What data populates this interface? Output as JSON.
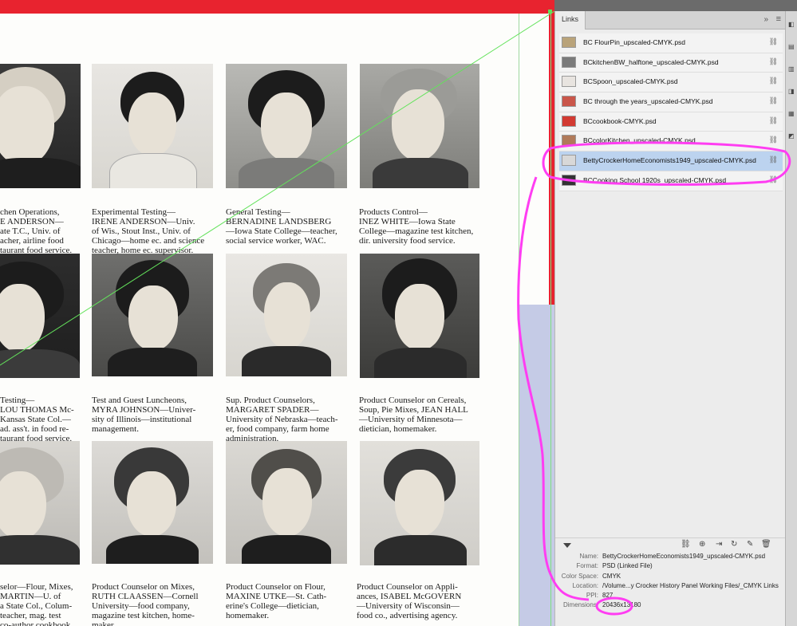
{
  "canvas": {
    "captions": [
      {
        "role": "chen Operations,",
        "lines": "E ANDERSON—\nate T.C., Univ. of\nacher, airline food\ntaurant food service."
      },
      {
        "role": "Experimental Testing—",
        "lines": "IRENE ANDERSON—Univ.\nof Wis., Stout Inst., Univ. of\nChicago—home ec. and science\nteacher, home ec. supervisor."
      },
      {
        "role": "General Testing—",
        "lines": "BERNADINE LANDSBERG\n—Iowa State College—teacher,\nsocial service worker, WAC."
      },
      {
        "role": "Products Control—",
        "lines": "INEZ WHITE—Iowa State\nCollege—magazine test kitchen,\ndir. university food service."
      },
      {
        "role": "Testing—",
        "lines": "LOU THOMAS Mc-\nKansas State Col.—\nad. ass't. in food re-\ntaurant food service."
      },
      {
        "role": "Test and Guest Luncheons,",
        "lines": "MYRA JOHNSON—Univer-\nsity of Illinois—institutional\nmanagement."
      },
      {
        "role": "Sup. Product Counselors,",
        "lines": "MARGARET SPADER—\nUniversity of Nebraska—teach-\ner, food company, farm home\nadministration."
      },
      {
        "role": "Product Counselor on Cereals,",
        "lines": "Soup, Pie Mixes, JEAN HALL\n—University of Minnesota—\ndietician, homemaker."
      },
      {
        "role": "selor—Flour, Mixes,",
        "lines": "MARTIN—U. of\na State Col., Colum-\nteacher, mag. test\nco-author cookbook."
      },
      {
        "role": "Product Counselor on Mixes,",
        "lines": "RUTH CLAASSEN—Cornell\nUniversity—food company,\nmagazine test kitchen, home-\nmaker."
      },
      {
        "role": "Product Counselor on Flour,",
        "lines": "MAXINE UTKE—St. Cath-\nerine's College—dietician,\nhomemaker."
      },
      {
        "role": "Product Counselor on Appli-",
        "lines": "ances, ISABEL McGOVERN\n—University of Wisconsin—\nfood co., advertising agency."
      }
    ]
  },
  "panel": {
    "tab_label": "Links",
    "collapse_glyph": "»",
    "menu_glyph": "≡",
    "links": [
      {
        "name": "BC FlourPin_upscaled-CMYK.psd",
        "thumb_color": "#b9a37a",
        "selected": false
      },
      {
        "name": "BCkitchenBW_halftone_upscaled-CMYK.psd",
        "thumb_color": "#7a7a7a",
        "selected": false
      },
      {
        "name": "BCSpoon_upscaled-CMYK.psd",
        "thumb_color": "#e8e4e0",
        "selected": false
      },
      {
        "name": "BC through the years_upscaled-CMYK.psd",
        "thumb_color": "#c9564a",
        "selected": false
      },
      {
        "name": "BCcookbook-CMYK.psd",
        "thumb_color": "#d23a32",
        "selected": false
      },
      {
        "name": "BCcolorKitchen_upscaled-CMYK.psd",
        "thumb_color": "#b07a5a",
        "selected": false
      },
      {
        "name": "BettyCrockerHomeEconomists1949_upscaled-CMYK.psd",
        "thumb_color": "#d8d8d8",
        "selected": true
      },
      {
        "name": "BCCooking School 1920s_upscaled-CMYK.psd",
        "thumb_color": "#333333",
        "selected": false
      }
    ],
    "info": [
      {
        "label": "Name:",
        "value": "BettyCrockerHomeEconomists1949_upscaled-CMYK.psd"
      },
      {
        "label": "Format:",
        "value": "PSD (Linked File)"
      },
      {
        "label": "Color Space:",
        "value": "CMYK"
      },
      {
        "label": "Location:",
        "value": "/Volume...y Crocker History Panel Working Files/_CMYK Links"
      },
      {
        "label": "PPI:",
        "value": "827"
      },
      {
        "label": "Dimensions:",
        "value": "20436x13180"
      }
    ]
  },
  "colors": {
    "bleed": "#e8232f",
    "selection": "#bcd3ef",
    "annotation": "#ff3df2",
    "link_line": "#63e25b"
  },
  "icons": [
    "link-chain-icon",
    "relink-icon",
    "goto-link-icon",
    "update-link-icon",
    "edit-original-icon",
    "trash-icon"
  ]
}
